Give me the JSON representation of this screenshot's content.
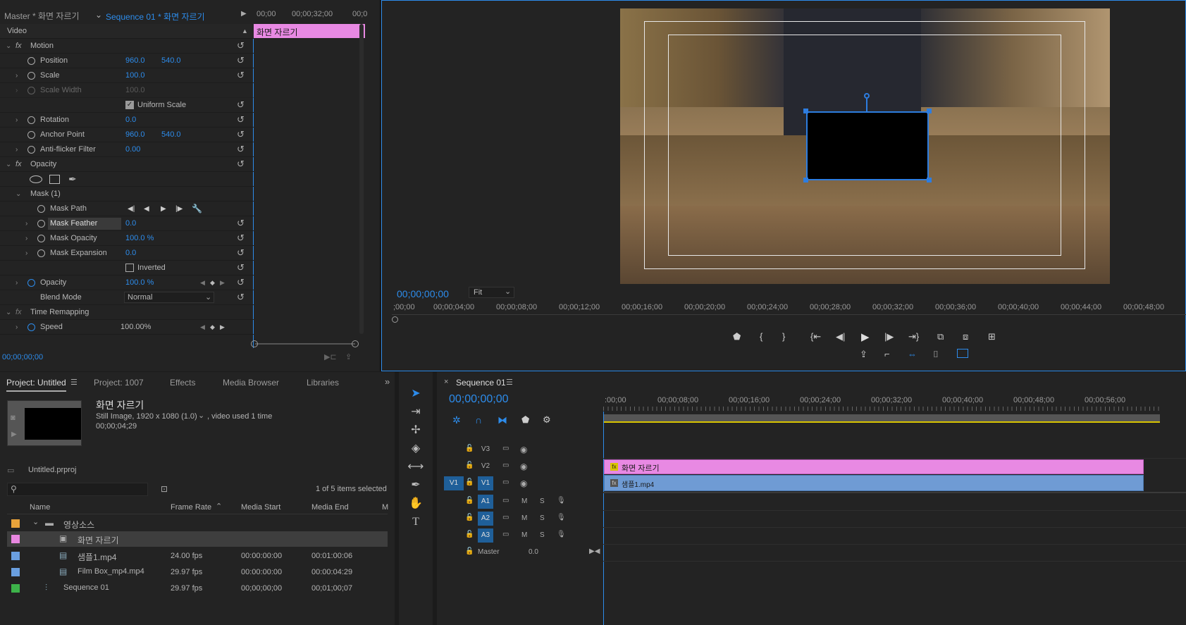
{
  "effect_controls": {
    "source_tab": "Master * 화면 자르기",
    "sequence_tab": "Sequence 01 * 화면 자르기",
    "ruler": [
      "00;00",
      "00;00;32;00",
      "00;0"
    ],
    "clip_name": "화면 자르기",
    "section_video": "Video",
    "motion": "Motion",
    "position_label": "Position",
    "position_x": "960.0",
    "position_y": "540.0",
    "scale_label": "Scale",
    "scale_val": "100.0",
    "scale_width_label": "Scale Width",
    "scale_width_val": "100.0",
    "uniform_scale": "Uniform Scale",
    "rotation_label": "Rotation",
    "rotation_val": "0.0",
    "anchor_label": "Anchor Point",
    "anchor_x": "960.0",
    "anchor_y": "540.0",
    "antiflicker_label": "Anti-flicker Filter",
    "antiflicker_val": "0.00",
    "opacity_section": "Opacity",
    "mask": "Mask (1)",
    "mask_path": "Mask Path",
    "mask_feather": "Mask Feather",
    "mask_feather_val": "0.0",
    "mask_opacity": "Mask Opacity",
    "mask_opacity_val": "100.0 %",
    "mask_expansion": "Mask Expansion",
    "mask_expansion_val": "0.0",
    "inverted": "Inverted",
    "opacity_label": "Opacity",
    "opacity_val": "100.0 %",
    "blend_label": "Blend Mode",
    "blend_val": "Normal",
    "time_remap": "Time Remapping",
    "speed_label": "Speed",
    "speed_val": "100.00%",
    "timecode": "00;00;00;00"
  },
  "program": {
    "timecode": "00;00;00;00",
    "fit": "Fit",
    "ruler": [
      ";00;00",
      "00;00;04;00",
      "00;00;08;00",
      "00;00;12;00",
      "00;00;16;00",
      "00;00;20;00",
      "00;00;24;00",
      "00;00;28;00",
      "00;00;32;00",
      "00;00;36;00",
      "00;00;40;00",
      "00;00;44;00",
      "00;00;48;00"
    ]
  },
  "project": {
    "tabs": [
      "Project: Untitled",
      "Project: 1007",
      "Effects",
      "Media Browser",
      "Libraries"
    ],
    "preview_title": "화면 자르기",
    "preview_info": "Still Image, 1920 x 1080 (1.0)",
    "preview_used": ", video used 1 time",
    "preview_dur": "00;00;04;29",
    "file": "Untitled.prproj",
    "selected": "1 of 5 items selected",
    "cols": [
      "Name",
      "Frame Rate",
      "Media Start",
      "Media End",
      "M"
    ],
    "rows": [
      {
        "name": "영상소스",
        "rate": "",
        "start": "",
        "end": "",
        "color": "#e8a33a"
      },
      {
        "name": "화면 자르기",
        "rate": "",
        "start": "",
        "end": "",
        "color": "#e887e0"
      },
      {
        "name": "샘플1.mp4",
        "rate": "24.00 fps",
        "start": "00:00:00:00",
        "end": "00:01:00:06",
        "color": "#6a9fe0"
      },
      {
        "name": "Film Box_mp4.mp4",
        "rate": "29.97 fps",
        "start": "00:00:00:00",
        "end": "00:00:04:29",
        "color": "#6a9fe0"
      },
      {
        "name": "Sequence 01",
        "rate": "29.97 fps",
        "start": "00;00;00;00",
        "end": "00;01;00;07",
        "color": "#3db34a"
      }
    ]
  },
  "timeline": {
    "title": "Sequence 01",
    "timecode": "00;00;00;00",
    "ruler": [
      ":00;00",
      "00;00;08;00",
      "00;00;16;00",
      "00;00;24;00",
      "00;00;32;00",
      "00;00;40;00",
      "00;00;48;00",
      "00;00;56;00"
    ],
    "tracks": [
      "V3",
      "V2",
      "V1",
      "A1",
      "A2",
      "A3"
    ],
    "v1_src": "V1",
    "master": "Master",
    "master_val": "0.0",
    "clip_v2": "화면 자르기",
    "clip_v1": "샘플1.mp4",
    "m": "M",
    "s": "S"
  }
}
